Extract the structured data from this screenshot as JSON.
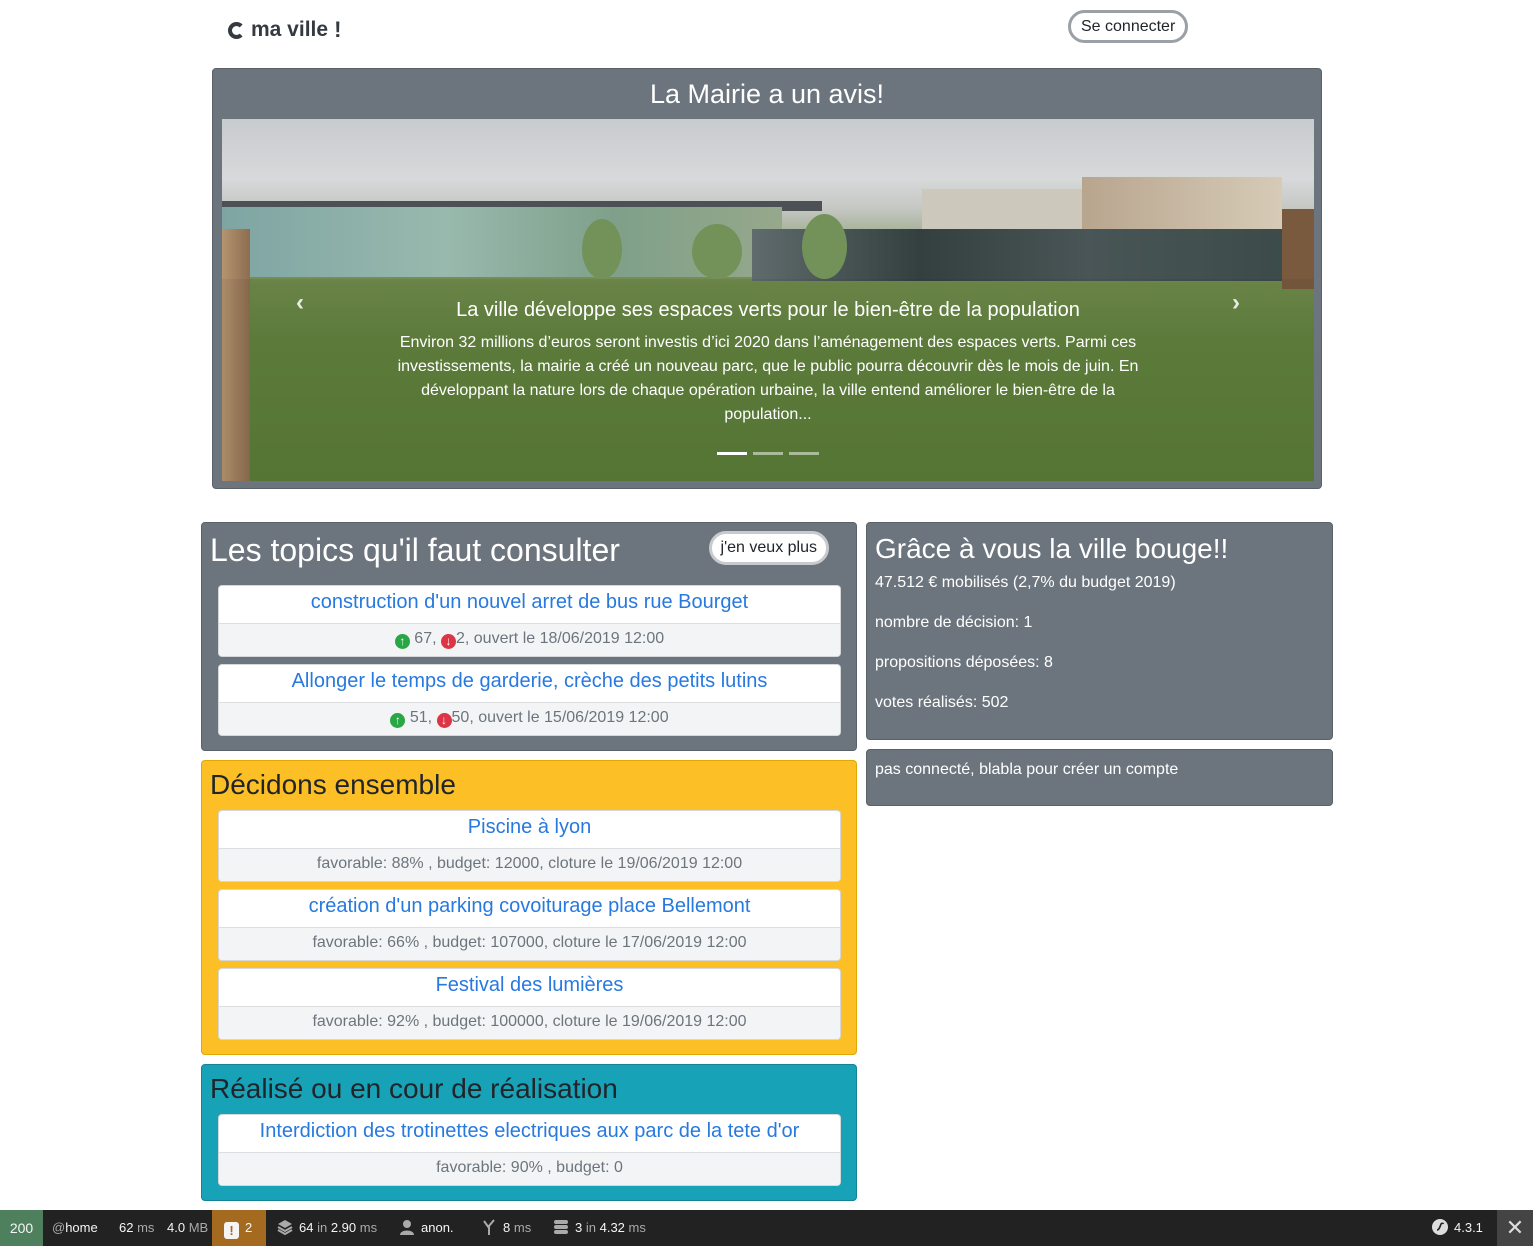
{
  "header": {
    "logo_text": "ma ville",
    "logo_bang": "!",
    "login_label": "Se connecter"
  },
  "carousel": {
    "title": "La Mairie a un avis!",
    "slide_title": "La ville développe ses espaces verts pour le bien-être de la population",
    "slide_text": "Environ 32 millions d’euros seront investis d’ici 2020 dans l’aménagement des espaces verts. Parmi ces investissements, la mairie a créé un nouveau parc, que le public pourra découvrir dès le mois de juin. En développant la nature lors de chaque opération urbaine, la ville entend améliorer le bien-être de la population...",
    "prev_icon": "chevron-left-icon",
    "next_icon": "chevron-right-icon",
    "prev_glyph": "‹",
    "next_glyph": "›",
    "active_slide": 1,
    "slide_count": 3
  },
  "topics": {
    "title": "Les topics qu'il faut consulter",
    "more_label": "j'en veux plus",
    "items": [
      {
        "title": "construction d'un nouvel arret de bus rue Bourget",
        "up": "67",
        "down": "2",
        "opened": ", ouvert le 18/06/2019 12:00"
      },
      {
        "title": "Allonger le temps de garderie, crèche des petits lutins",
        "up": "51",
        "down": "50",
        "opened": ", ouvert le 15/06/2019 12:00"
      }
    ]
  },
  "decisions": {
    "title": "Décidons ensemble",
    "items": [
      {
        "title": "Piscine à lyon",
        "info": "favorable: 88% , budget: 12000, cloture le 19/06/2019 12:00"
      },
      {
        "title": "création d'un parking covoiturage place Bellemont",
        "info": "favorable: 66% , budget: 107000, cloture le 17/06/2019 12:00"
      },
      {
        "title": "Festival des lumières",
        "info": "favorable: 92% , budget: 100000, cloture le 19/06/2019 12:00"
      }
    ]
  },
  "realised": {
    "title": "Réalisé ou en cour de réalisation",
    "items": [
      {
        "title": "Interdiction des trotinettes electriques aux parc de la tete d'or",
        "info": "favorable: 90% , budget: 0"
      }
    ]
  },
  "stats": {
    "title": "Grâce à vous la ville bouge!!",
    "mobilised": "47.512 € mobilisés (2,7% du budget 2019)",
    "decisions": "nombre de décision: 1",
    "proposals": "propositions déposées: 8",
    "votes": "votes réalisés: 502"
  },
  "login_notice": {
    "text": "pas connecté, blabla pour créer un compte"
  },
  "profiler": {
    "status": "200",
    "route_prefix": "@",
    "route": "home",
    "time_value": "62",
    "time_unit": "ms",
    "memory_value": "4.0",
    "memory_unit": "MB",
    "warnings": "2",
    "cache_count": "64",
    "cache_in": "in",
    "cache_time": "2.90",
    "cache_unit": "ms",
    "user": "anon.",
    "twig_time": "8",
    "twig_unit": "ms",
    "db_count": "3",
    "db_in": "in",
    "db_time": "4.32",
    "db_unit": "ms",
    "version": "4.3.1",
    "close_glyph": "✕",
    "colors": {
      "status": "#4f805d",
      "warning": "#a46a1f",
      "bar": "#222222"
    }
  },
  "colors": {
    "gray_panel": "#6c757d",
    "yellow_panel": "#fdbf26",
    "teal_panel": "#17a2b8",
    "link": "#2779e0",
    "up_arrow": "#28a745",
    "down_arrow": "#dc3545"
  }
}
